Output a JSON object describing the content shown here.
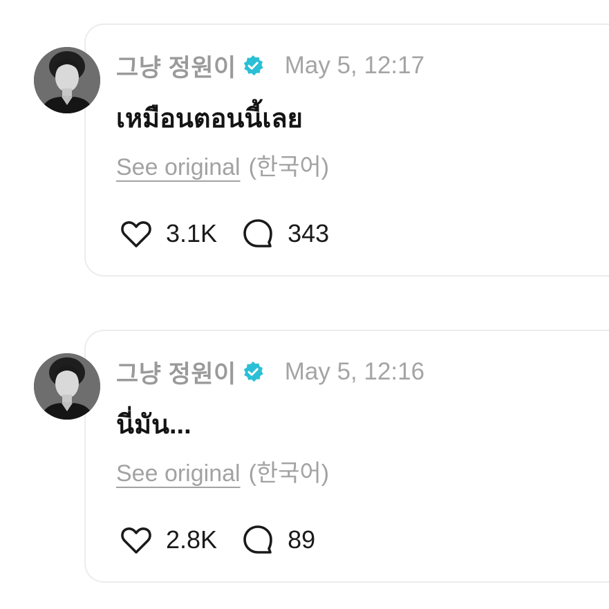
{
  "colors": {
    "verified_badge": "#2bbfd6",
    "muted_text": "#9a9a9a",
    "body_text": "#141414",
    "card_border": "#ececec"
  },
  "posts": [
    {
      "username": "그냥 정원이",
      "verified_icon": "verified-badge-icon",
      "timestamp": "May 5, 12:17",
      "text": "เหมือนตอนนี้เลย",
      "see_original": "See original",
      "language": "(한국어)",
      "likes": "3.1K",
      "comments": "343"
    },
    {
      "username": "그냥 정원이",
      "verified_icon": "verified-badge-icon",
      "timestamp": "May 5, 12:16",
      "text": "นี่มัน...",
      "see_original": "See original",
      "language": "(한국어)",
      "likes": "2.8K",
      "comments": "89"
    }
  ]
}
